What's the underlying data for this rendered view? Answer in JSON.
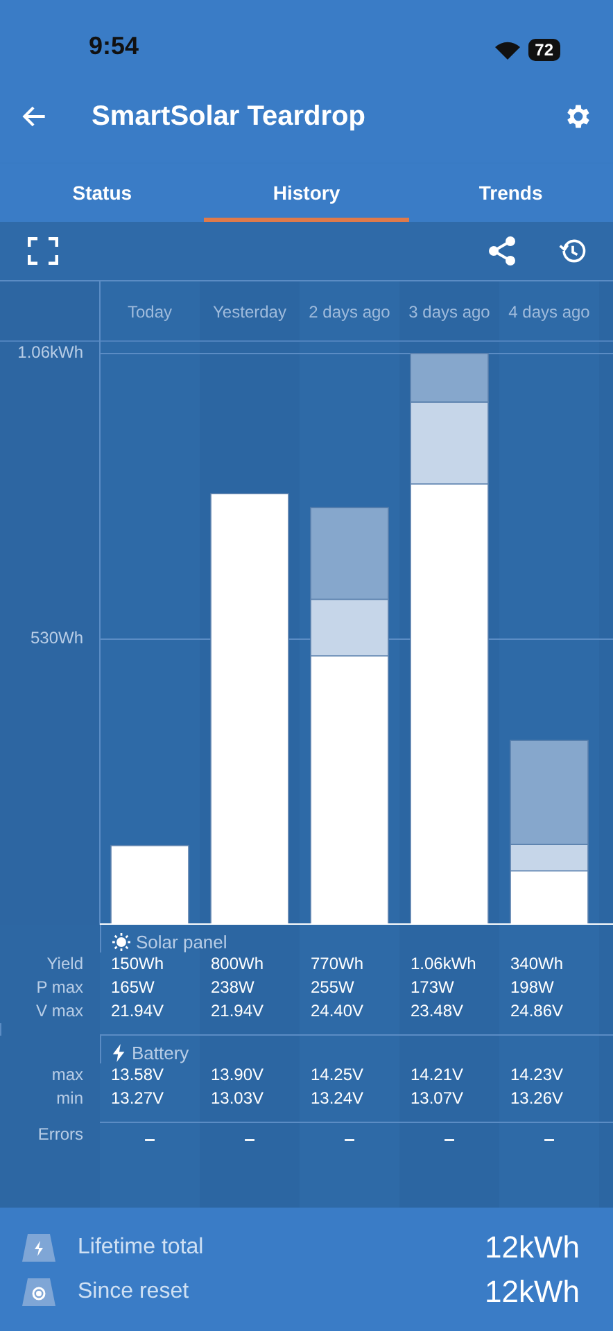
{
  "status_bar": {
    "time": "9:54",
    "battery": "72"
  },
  "header": {
    "title": "SmartSolar Teardrop"
  },
  "tabs": [
    {
      "label": "Status",
      "selected": false
    },
    {
      "label": "History",
      "selected": true
    },
    {
      "label": "Trends",
      "selected": false
    }
  ],
  "chart": {
    "categories": [
      "Today",
      "Yesterday",
      "2 days ago",
      "3 days ago",
      "4 days ago"
    ],
    "axis_labels": [
      "1.06kWh",
      "530Wh"
    ]
  },
  "table": {
    "sections": [
      {
        "kind": "solar",
        "title": "Solar panel",
        "rows": [
          {
            "label": "Yield",
            "values": [
              "150Wh",
              "800Wh",
              "770Wh",
              "1.06kWh",
              "340Wh"
            ]
          },
          {
            "label": "P max",
            "values": [
              "165W",
              "238W",
              "255W",
              "173W",
              "198W"
            ]
          },
          {
            "label": "V max",
            "values": [
              "21.94V",
              "21.94V",
              "24.40V",
              "23.48V",
              "24.86V"
            ]
          }
        ]
      },
      {
        "kind": "battery",
        "title": "Battery",
        "rows": [
          {
            "label": "max",
            "values": [
              "13.58V",
              "13.90V",
              "14.25V",
              "14.21V",
              "14.23V"
            ]
          },
          {
            "label": "min",
            "values": [
              "13.27V",
              "13.03V",
              "13.24V",
              "13.07V",
              "13.26V"
            ]
          }
        ]
      }
    ],
    "errors": {
      "label": "Errors",
      "values": [
        "–",
        "–",
        "–",
        "–",
        "–"
      ]
    }
  },
  "totals": [
    {
      "kind": "lifetime",
      "label": "Lifetime total",
      "value": "12kWh"
    },
    {
      "kind": "reset",
      "label": "Since reset",
      "value": "12kWh"
    }
  ]
}
